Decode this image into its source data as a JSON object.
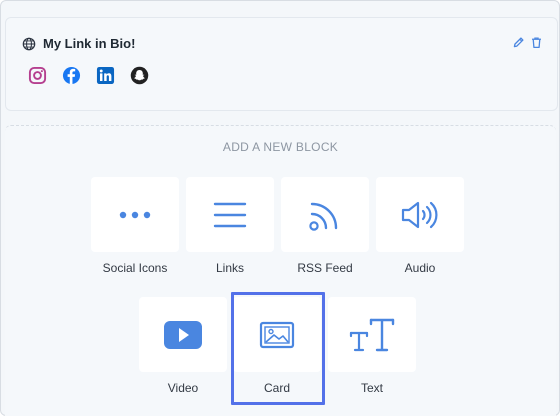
{
  "profile": {
    "title": "My Link in Bio!",
    "icons": [
      "globe-icon",
      "pencil-icon",
      "trash-icon"
    ],
    "socials": [
      "instagram-icon",
      "facebook-icon",
      "linkedin-icon",
      "snapchat-icon"
    ]
  },
  "blocks": {
    "heading": "ADD A NEW BLOCK",
    "items": [
      {
        "label": "Social Icons",
        "icon": "dots-icon"
      },
      {
        "label": "Links",
        "icon": "lines-icon"
      },
      {
        "label": "RSS Feed",
        "icon": "rss-icon"
      },
      {
        "label": "Audio",
        "icon": "speaker-icon"
      },
      {
        "label": "Video",
        "icon": "play-icon"
      },
      {
        "label": "Card",
        "icon": "image-icon",
        "selected": true
      },
      {
        "label": "Text",
        "icon": "text-icon"
      }
    ]
  },
  "colors": {
    "accent": "#4a86e0",
    "selection": "#5371e9",
    "instagram": "#b53f8f",
    "facebook": "#1877f2",
    "linkedin": "#0a66c2",
    "snapchat": "#222222"
  }
}
